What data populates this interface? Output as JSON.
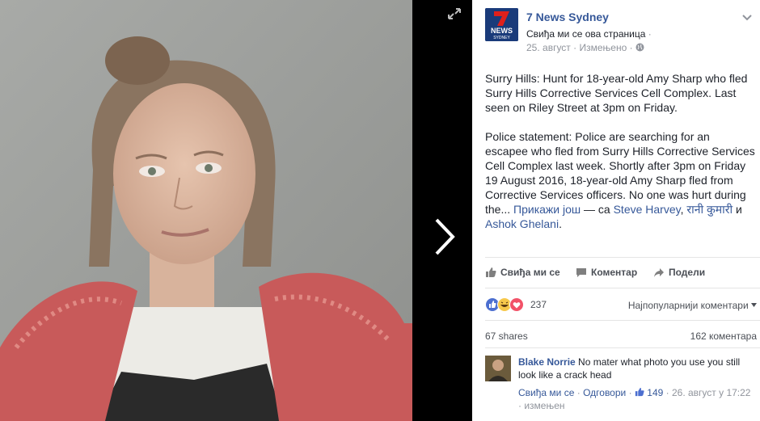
{
  "post": {
    "page_name": "7 News Sydney",
    "logo_text": "NEWS",
    "logo_sub": "SYDNEY",
    "like_page": "Свиђа ми се ова страница",
    "date": "25. август",
    "edited": "Измењено",
    "paragraph1": "Surry Hills: Hunt for 18-year-old Amy Sharp who fled Surry Hills Corrective Services Cell Complex. Last seen on Riley Street at 3pm on Friday.",
    "paragraph2": "Police statement: Police are searching for an escapee who fled from Surry Hills Corrective Services Cell Complex last week. Shortly after 3pm on Friday 19 August 2016, 18-year-old Amy Sharp fled from Corrective Services officers. No one was hurt during the...",
    "see_more": "Прикажи још",
    "with_prefix": "— са",
    "tag1": "Steve Harvey",
    "tag2": "रानी कुमारी",
    "tag_and": "и",
    "tag3": "Ashok Ghelani"
  },
  "actions": {
    "like": "Свиђа ми се",
    "comment": "Коментар",
    "share": "Подели"
  },
  "stats": {
    "reactions": "237",
    "sort": "Најпопуларнији коментари",
    "shares": "67 shares",
    "comments": "162 коментара"
  },
  "comment": {
    "author": "Blake Norrie",
    "text": "No mater what photo you use you still look like a crack head",
    "like": "Свиђа ми се",
    "reply": "Одговори",
    "likes": "149",
    "date": "26. август у 17:22",
    "edited": "измењен"
  },
  "colors": {
    "brand_blue": "#365899",
    "muted": "#90949c",
    "logo_red": "#e0201b"
  }
}
